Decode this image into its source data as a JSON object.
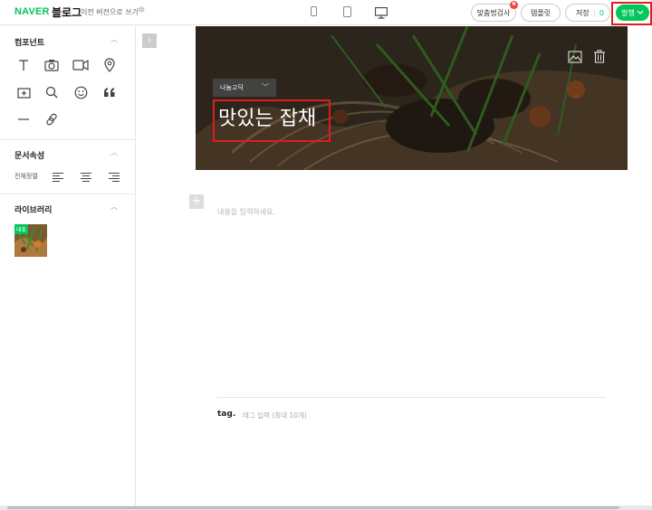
{
  "header": {
    "naver": "NAVER",
    "blog": "블로그",
    "prev_version": "이전 버전으로 쓰기",
    "spell_check": "맞춤법검사",
    "spell_badge": "N",
    "template": "템플릿",
    "save": "저장",
    "save_count": "0",
    "publish": "발행"
  },
  "sidebar": {
    "components_title": "컴포넌트",
    "doc_props_title": "문서속성",
    "align_label": "전체정렬",
    "library_title": "라이브러리",
    "library_badge": "대표",
    "component_icons": [
      "text-icon",
      "camera-icon",
      "video-icon",
      "location-pin-icon",
      "image-add-icon",
      "search-icon",
      "emoji-icon",
      "quote-icon",
      "divider-icon",
      "link-icon"
    ]
  },
  "cover": {
    "font_name": "나눔고딕",
    "title": "맛있는 잡채"
  },
  "editor": {
    "body_placeholder": "내용을 입력하세요.",
    "tag_label": "tag.",
    "tag_placeholder": "태그 입력 (최대 10개)"
  },
  "colors": {
    "accent": "#03c75a",
    "highlight": "#e21b1b"
  }
}
